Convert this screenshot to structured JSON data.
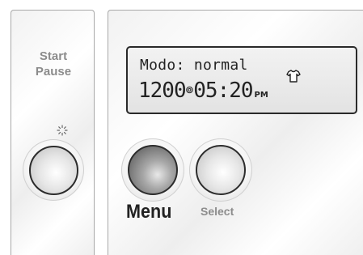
{
  "controls": {
    "start_pause": {
      "line1": "Start",
      "line2": "Pause",
      "icon": "led-indicator-icon"
    },
    "menu": {
      "label": "Menu"
    },
    "select": {
      "label": "Select"
    }
  },
  "display": {
    "line1": "Modo: normal",
    "load": "1200",
    "time": "05:20",
    "period": "PM",
    "icons": [
      "spin-icon",
      "shirt-icon"
    ]
  }
}
